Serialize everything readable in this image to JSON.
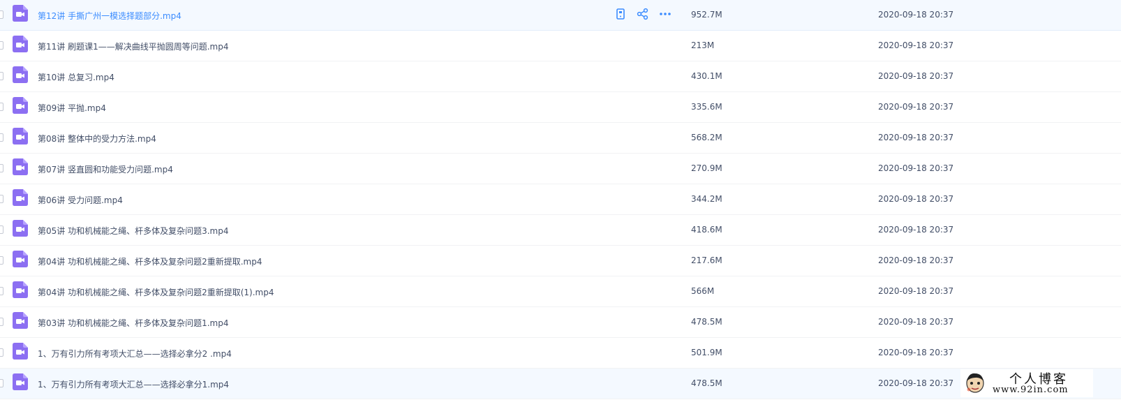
{
  "files": [
    {
      "name": "第12讲 手撕广州一模选择题部分.mp4",
      "size": "952.7M",
      "modified": "2020-09-18 20:37",
      "hovered": true
    },
    {
      "name": "第11讲 刷题课1——解决曲线平抛圆周等问题.mp4",
      "size": "213M",
      "modified": "2020-09-18 20:37"
    },
    {
      "name": "第10讲 总复习.mp4",
      "size": "430.1M",
      "modified": "2020-09-18 20:37"
    },
    {
      "name": "第09讲 平抛.mp4",
      "size": "335.6M",
      "modified": "2020-09-18 20:37"
    },
    {
      "name": "第08讲 整体中的受力方法.mp4",
      "size": "568.2M",
      "modified": "2020-09-18 20:37"
    },
    {
      "name": "第07讲 竖直圆和功能受力问题.mp4",
      "size": "270.9M",
      "modified": "2020-09-18 20:37"
    },
    {
      "name": "第06讲 受力问题.mp4",
      "size": "344.2M",
      "modified": "2020-09-18 20:37"
    },
    {
      "name": "第05讲 功和机械能之绳、杆多体及复杂问题3.mp4",
      "size": "418.6M",
      "modified": "2020-09-18 20:37"
    },
    {
      "name": "第04讲 功和机械能之绳、杆多体及复杂问题2重新提取.mp4",
      "size": "217.6M",
      "modified": "2020-09-18 20:37"
    },
    {
      "name": "第04讲 功和机械能之绳、杆多体及复杂问题2重新提取(1).mp4",
      "size": "566M",
      "modified": "2020-09-18 20:37"
    },
    {
      "name": "第03讲 功和机械能之绳、杆多体及复杂问题1.mp4",
      "size": "478.5M",
      "modified": "2020-09-18 20:37"
    },
    {
      "name": "1、万有引力所有考项大汇总——选择必拿分2 .mp4",
      "size": "501.9M",
      "modified": "2020-09-18 20:37"
    },
    {
      "name": "1、万有引力所有考项大汇总——选择必拿分1.mp4",
      "size": "478.5M",
      "modified": "2020-09-18 20:37"
    }
  ],
  "row_actions": {
    "icons": [
      "phone-icon",
      "share-icon",
      "more-icon"
    ]
  },
  "watermark": {
    "title": "个人博客",
    "url": "www.92in.com"
  },
  "colors": {
    "accent": "#3b8cff",
    "video_icon": "#8c6ff2",
    "text": "#424e67",
    "hover_bg": "#f4f9ff"
  }
}
